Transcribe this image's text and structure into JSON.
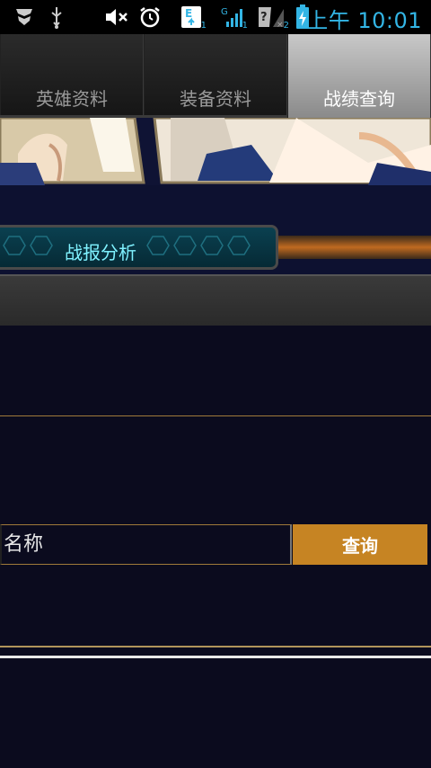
{
  "status_bar": {
    "time": "上午 10:01",
    "signal_sub_1": "1",
    "signal_sub_2": "1",
    "unknown_sub": "2",
    "icons": [
      "shield-icon",
      "usb-icon",
      "mute-icon",
      "alarm-icon",
      "e-network-icon",
      "signal-icon",
      "no-sim-icon",
      "battery-charging-icon"
    ]
  },
  "tabs": [
    {
      "label": "英雄资料",
      "active": false
    },
    {
      "label": "装备资料",
      "active": false
    },
    {
      "label": "战绩查询",
      "active": true
    }
  ],
  "analysis": {
    "label": "战报分析"
  },
  "search": {
    "placeholder": "名称",
    "button": "查询"
  },
  "colors": {
    "accent": "#c68423",
    "background": "#0b0b1e",
    "cyan": "#7ff2ff",
    "status_blue": "#33b5e5"
  }
}
